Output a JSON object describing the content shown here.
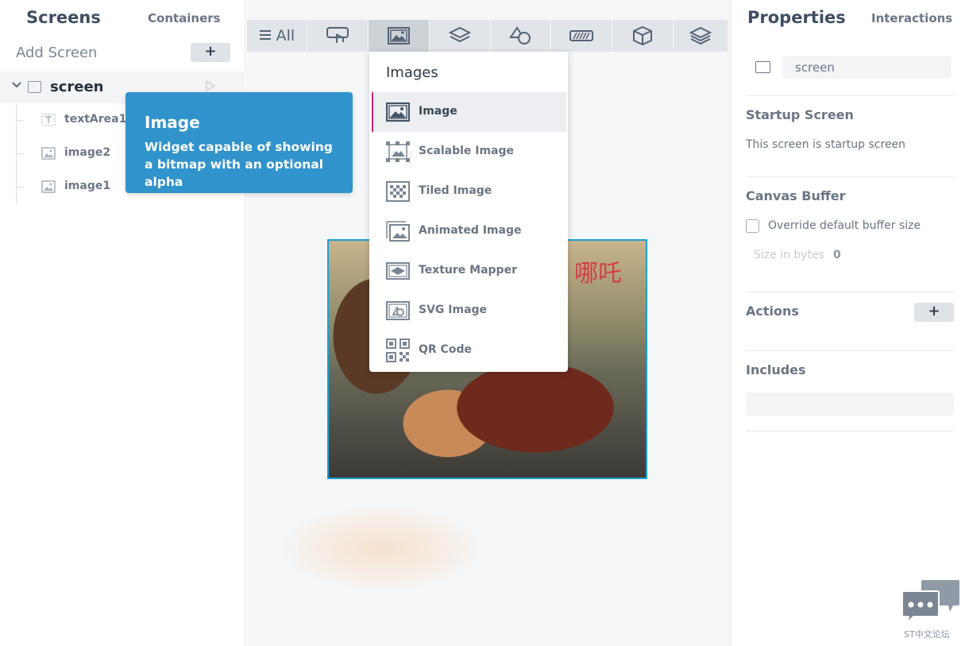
{
  "left_panel": {
    "tabs": {
      "screens": "Screens",
      "containers": "Containers"
    },
    "add_screen_label": "Add Screen",
    "add_button": "+",
    "root": {
      "label": "screen",
      "icon": "screen-icon"
    },
    "items": [
      {
        "label": "textArea1",
        "icon": "text-area-icon"
      },
      {
        "label": "image2",
        "icon": "image-icon"
      },
      {
        "label": "image1",
        "icon": "image-icon"
      }
    ]
  },
  "tooltip": {
    "title": "Image",
    "description": "Widget capable of showing a bitmap with an optional alpha"
  },
  "toolbar": {
    "all_label": "All",
    "buttons": [
      "touch-icon",
      "image-icon",
      "layers-icon",
      "shapes-icon",
      "progress-icon",
      "cube-icon",
      "stack-icon"
    ],
    "active_index": 1
  },
  "dropdown": {
    "title": "Images",
    "items": [
      {
        "label": "Image",
        "icon": "image-icon",
        "selected": true
      },
      {
        "label": "Scalable Image",
        "icon": "scalable-image-icon"
      },
      {
        "label": "Tiled Image",
        "icon": "tiled-image-icon"
      },
      {
        "label": "Animated Image",
        "icon": "animated-image-icon"
      },
      {
        "label": "Texture Mapper",
        "icon": "texture-mapper-icon"
      },
      {
        "label": "SVG Image",
        "icon": "svg-image-icon"
      },
      {
        "label": "QR Code",
        "icon": "qr-code-icon"
      }
    ]
  },
  "canvas": {
    "overlay_text": "哪吒",
    "selection_color": "#1aa0d8"
  },
  "right_panel": {
    "tabs": {
      "properties": "Properties",
      "interactions": "Interactions"
    },
    "name_value": "screen",
    "startup": {
      "title": "Startup Screen",
      "text": "This screen is startup screen"
    },
    "canvas_buffer": {
      "title": "Canvas Buffer",
      "override_label": "Override default buffer size",
      "override_checked": false,
      "size_label": "Size in bytes",
      "size_value": "0"
    },
    "actions": {
      "title": "Actions",
      "add_button": "+"
    },
    "includes": {
      "title": "Includes"
    }
  },
  "forum_badge": {
    "label": "ST中文论坛"
  },
  "colors": {
    "accent": "#3193cb",
    "selected_marker": "#c4267a",
    "toolbar_bg": "#e1e4e8"
  }
}
